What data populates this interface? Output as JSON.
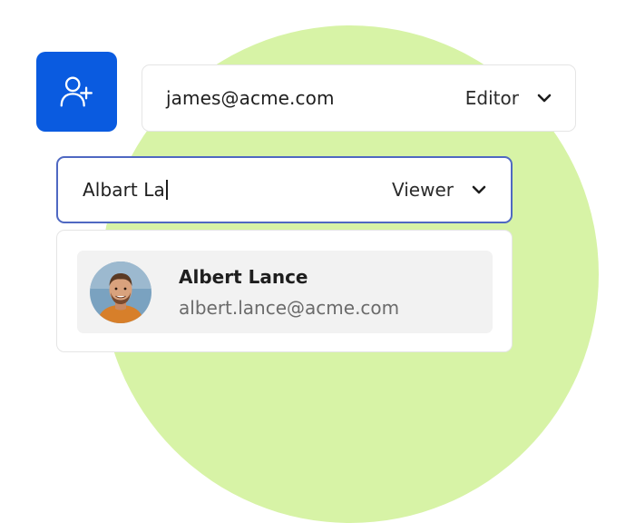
{
  "colors": {
    "accent": "#0a5be0",
    "background_blob": "#d7f3a6",
    "focus_border": "#4f68c2",
    "suggestion_bg": "#f2f2f2"
  },
  "invite_row": {
    "email": "james@acme.com",
    "role": "Editor",
    "role_icon": "chevron-down-icon"
  },
  "add_user": {
    "icon": "user-plus-icon"
  },
  "search_row": {
    "query": "Albart La",
    "role": "Viewer",
    "role_icon": "chevron-down-icon"
  },
  "suggestions": [
    {
      "name": "Albert Lance",
      "email": "albert.lance@acme.com",
      "avatar": "avatar-photo"
    }
  ]
}
